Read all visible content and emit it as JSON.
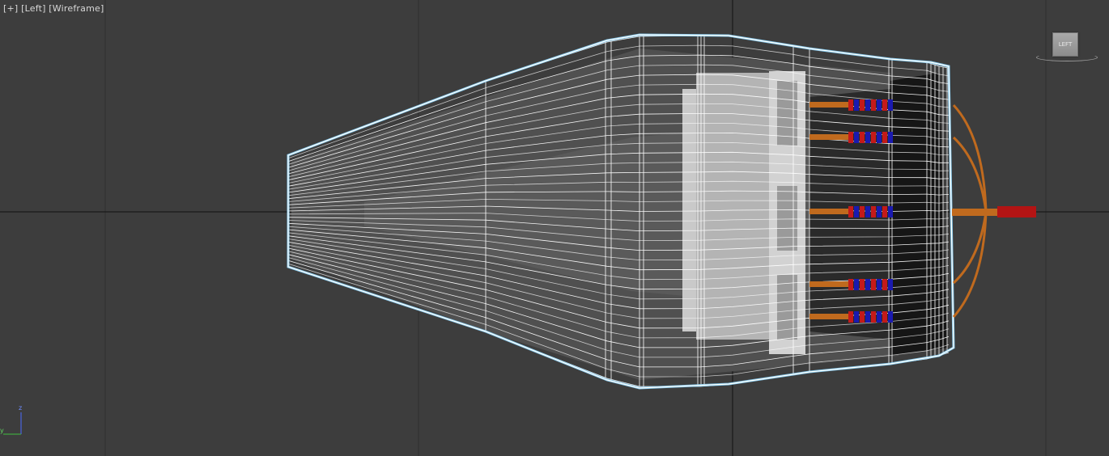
{
  "viewport": {
    "label_plus": "[+]",
    "label_view": "[Left]",
    "label_shading": "[Wireframe]"
  },
  "viewcube": {
    "face_label": "LEFT"
  },
  "axis_tripod": {
    "y_label": "y",
    "z_label": "z"
  },
  "colors": {
    "background": "#3d3d3d",
    "grid": "#2e2e2e",
    "world_axis": "#111111",
    "wireframe": "#ffffff",
    "selection_outline": "#8fd8ff",
    "shading_light": "#d6d6d6",
    "shading_dark": "#1a1a1a",
    "wire_orange": "#c06a1e",
    "wire_red": "#c41a1a",
    "wire_blue": "#1a1ab0"
  }
}
